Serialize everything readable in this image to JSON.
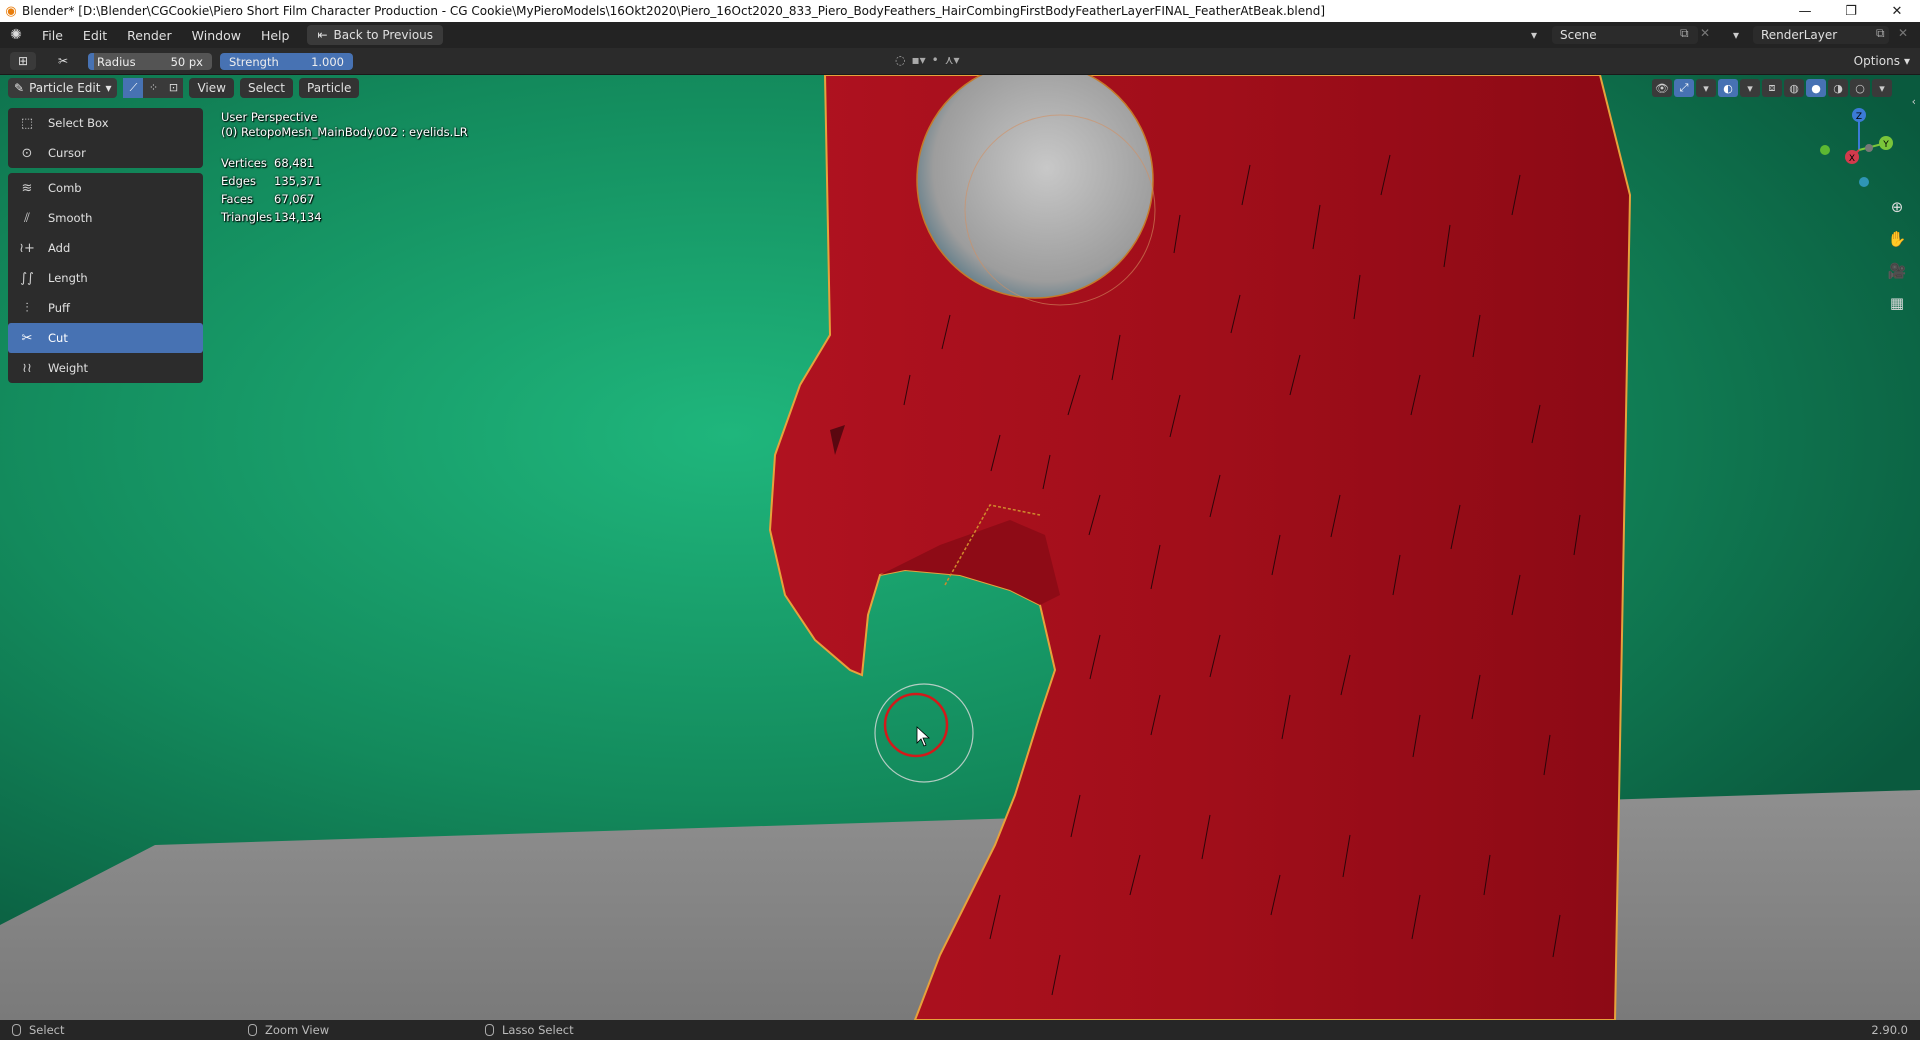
{
  "window": {
    "title": "Blender* [D:\\Blender\\CGCookie\\Piero Short Film Character Production - CG Cookie\\MyPieroModels\\16Okt2020\\Piero_16Oct2020_833_Piero_BodyFeathers_HairCombingFirstBodyFeatherLayerFINAL_FeatherAtBeak.blend]",
    "minimize": "—",
    "restore": "❐",
    "close": "✕"
  },
  "menu": {
    "items": [
      "File",
      "Edit",
      "Render",
      "Window",
      "Help"
    ],
    "back_button": "Back to Previous",
    "scene_label": "Scene",
    "renderlayer_label": "RenderLayer"
  },
  "tool_header": {
    "radius_label": "Radius",
    "radius_value": "50 px",
    "strength_label": "Strength",
    "strength_value": "1.000",
    "options_label": "Options"
  },
  "viewport_header": {
    "mode": "Particle Edit",
    "menus": [
      "View",
      "Select",
      "Particle"
    ]
  },
  "toolbar": {
    "group1": [
      {
        "label": "Select Box",
        "icon": "select-box-icon"
      },
      {
        "label": "Cursor",
        "icon": "cursor-icon"
      }
    ],
    "group2": [
      {
        "label": "Comb",
        "icon": "comb-icon"
      },
      {
        "label": "Smooth",
        "icon": "smooth-icon"
      },
      {
        "label": "Add",
        "icon": "add-icon"
      },
      {
        "label": "Length",
        "icon": "length-icon"
      },
      {
        "label": "Puff",
        "icon": "puff-icon"
      },
      {
        "label": "Cut",
        "icon": "cut-icon",
        "active": true
      },
      {
        "label": "Weight",
        "icon": "weight-icon"
      }
    ]
  },
  "overlay": {
    "view_name": "User Perspective",
    "object_info": "(0) RetopoMesh_MainBody.002 : eyelids.LR",
    "stats": [
      {
        "label": "Vertices",
        "value": "68,481"
      },
      {
        "label": "Edges",
        "value": "135,371"
      },
      {
        "label": "Faces",
        "value": "67,067"
      },
      {
        "label": "Triangles",
        "value": "134,134"
      }
    ]
  },
  "gizmo": {
    "z": "Z",
    "y": "Y",
    "x": "X"
  },
  "statusbar": {
    "left": "Select",
    "middle": "Zoom View",
    "right": "Lasso Select",
    "version": "2.90.0"
  },
  "colors": {
    "accent": "#4772b3",
    "bird_red": "#a5111a",
    "background_green": "#1fa673",
    "floor_grey": "#8a8a8a"
  }
}
